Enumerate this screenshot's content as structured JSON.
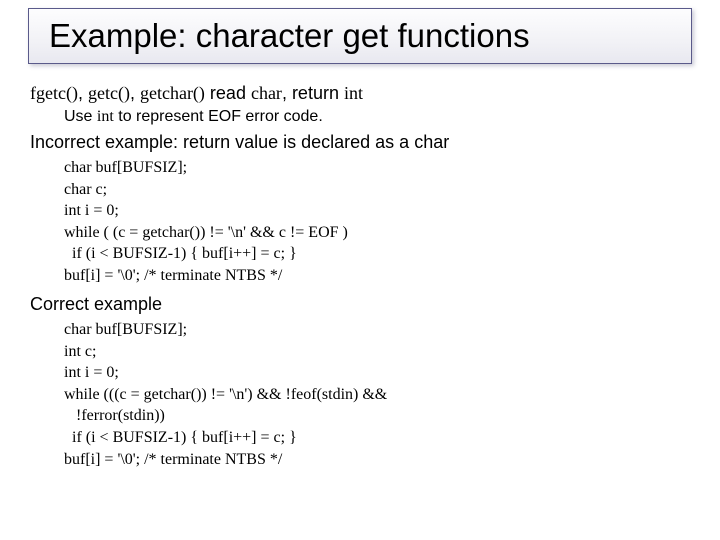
{
  "title": "Example: character get functions",
  "line1_a": "fgetc()",
  "line1_b": ", ",
  "line1_c": "getc()",
  "line1_d": ", ",
  "line1_e": "getchar()",
  "line1_f": " read ",
  "line1_g": "char",
  "line1_h": ", return ",
  "line1_i": "int",
  "line2_a": "Use ",
  "line2_b": "int",
  "line2_c": " to represent EOF error code.",
  "line3": "Incorrect example: return value is declared as a char",
  "code1": [
    "char buf[BUFSIZ];",
    "char c;",
    "int i = 0;",
    "while ( (c = getchar()) != '\\n' && c != EOF )",
    "  if (i < BUFSIZ-1) { buf[i++] = c; }",
    "buf[i] = '\\0'; /* terminate NTBS */"
  ],
  "line4": "Correct example",
  "code2": [
    "char buf[BUFSIZ];",
    "int c;",
    "int i = 0;",
    "while (((c = getchar()) != '\\n') && !feof(stdin) &&",
    "   !ferror(stdin))",
    "  if (i < BUFSIZ-1) { buf[i++] = c; }",
    "buf[i] = '\\0'; /* terminate NTBS */"
  ]
}
